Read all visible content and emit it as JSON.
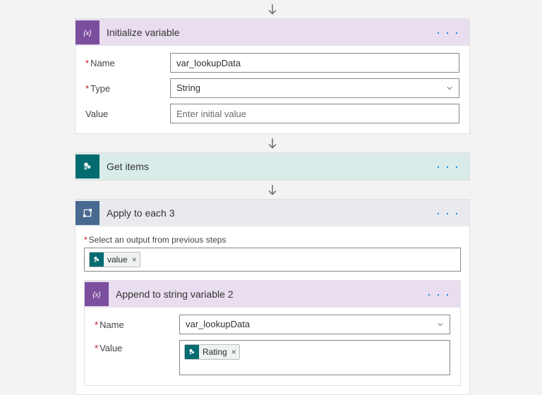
{
  "arrow": true,
  "card_initvar": {
    "title": "Initialize variable",
    "name_label": "Name",
    "name_value": "var_lookupData",
    "type_label": "Type",
    "type_value": "String",
    "value_label": "Value",
    "value_placeholder": "Enter initial value"
  },
  "card_getitems": {
    "title": "Get items"
  },
  "card_loop": {
    "title": "Apply to each 3",
    "select_label": "Select an output from previous steps",
    "token_value": "value"
  },
  "card_append": {
    "title": "Append to string variable 2",
    "name_label": "Name",
    "name_value": "var_lookupData",
    "value_label": "Value",
    "token_value": "Rating"
  },
  "ui": {
    "dots": "· · ·",
    "close_x": "×"
  }
}
